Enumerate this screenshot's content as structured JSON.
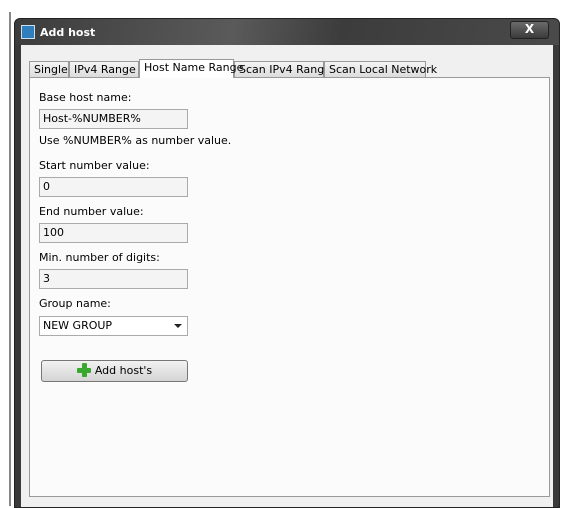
{
  "window": {
    "title": "Add host",
    "close_label": "X"
  },
  "tabs": [
    {
      "label": "Single"
    },
    {
      "label": "IPv4 Range"
    },
    {
      "label": "Host Name Range",
      "active": true
    },
    {
      "label": "Scan IPv4 Range"
    },
    {
      "label": "Scan Local Network"
    }
  ],
  "form": {
    "base_label": "Base host name:",
    "base_value": "Host-%NUMBER%",
    "hint": "Use %NUMBER% as number value.",
    "start_label": "Start number value:",
    "start_value": "0",
    "end_label": "End number value:",
    "end_value": "100",
    "digits_label": "Min. number of digits:",
    "digits_value": "3",
    "group_label": "Group name:",
    "group_value": "NEW GROUP",
    "add_button": "Add host's"
  },
  "icons": {
    "add": "plus-icon",
    "dropdown": "chevron-down-icon"
  }
}
